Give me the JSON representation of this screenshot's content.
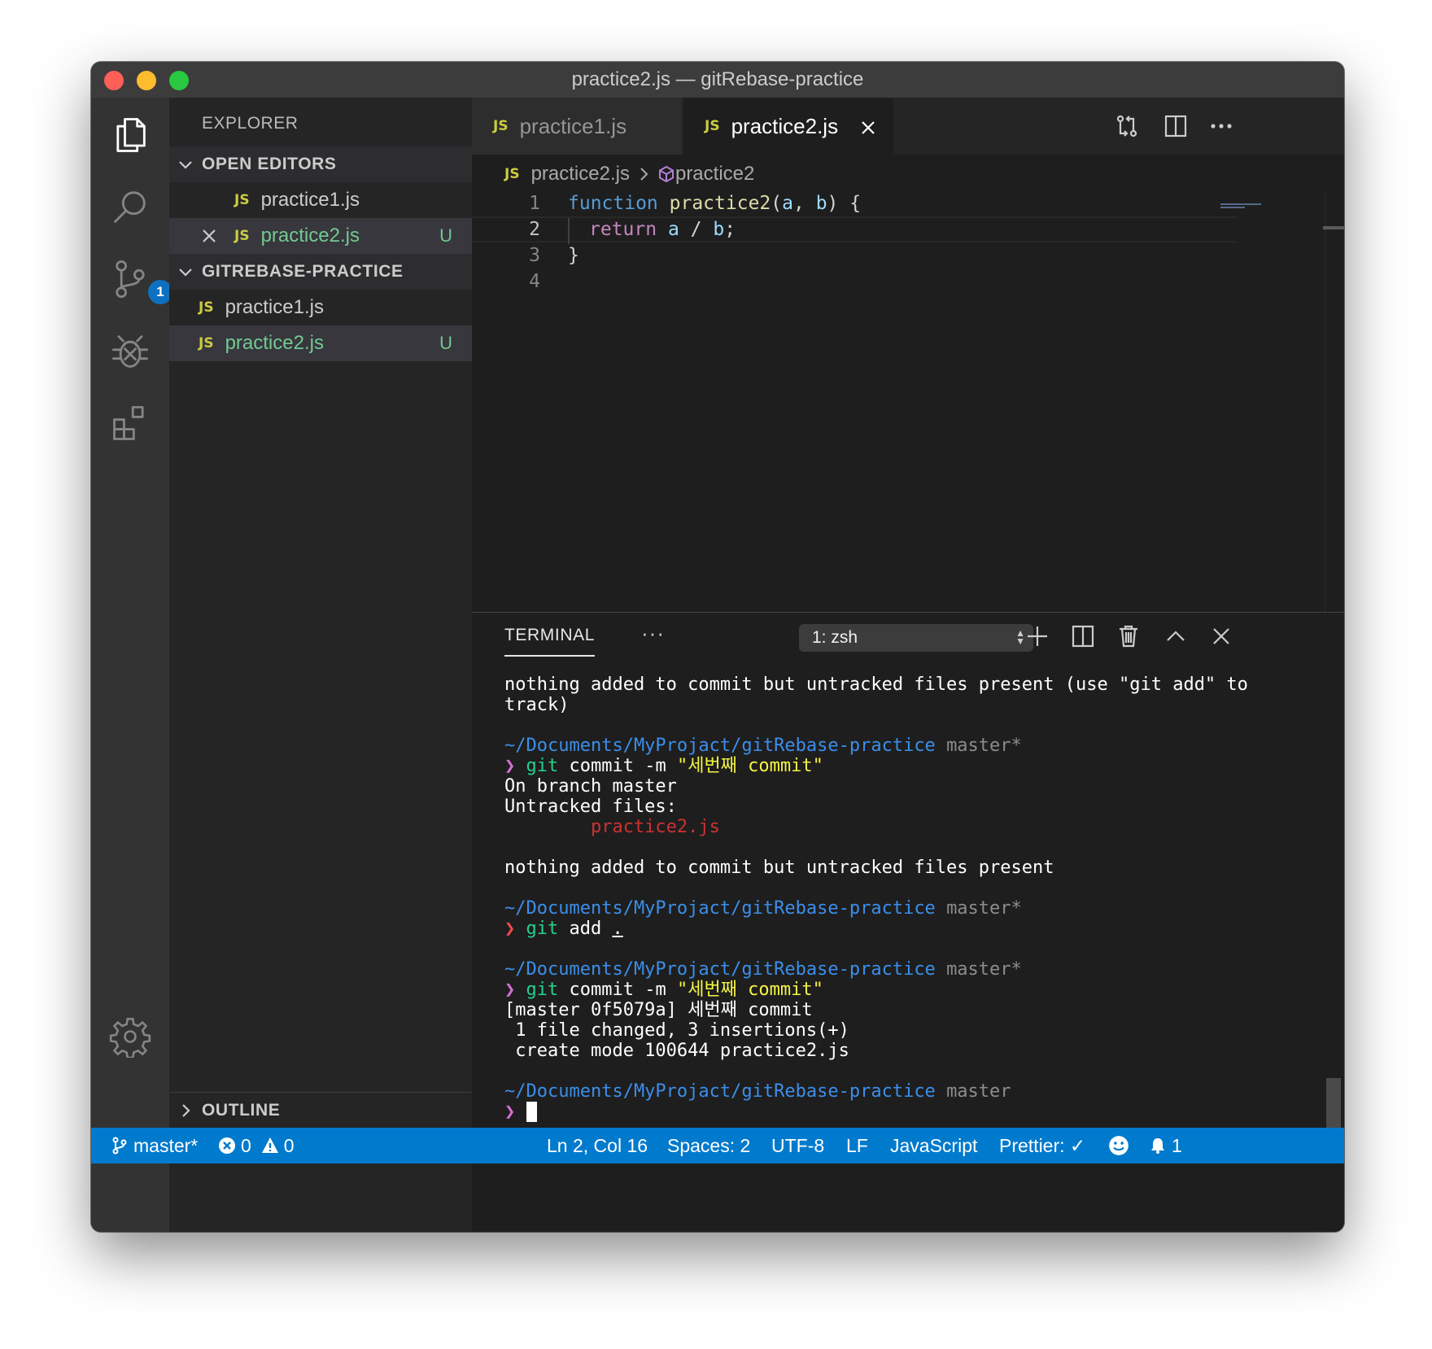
{
  "window": {
    "title": "practice2.js — gitRebase-practice"
  },
  "activity_bar": {
    "items": [
      "files-icon",
      "search-icon",
      "source-control-icon",
      "debug-icon",
      "extensions-icon"
    ],
    "scm_badge": "1"
  },
  "sidebar": {
    "title": "EXPLORER",
    "open_editors": {
      "label": "OPEN EDITORS",
      "items": [
        {
          "badge": "JS",
          "name": "practice1.js",
          "status": ""
        },
        {
          "badge": "JS",
          "name": "practice2.js",
          "status": "U"
        }
      ]
    },
    "workspace": {
      "label": "GITREBASE-PRACTICE",
      "items": [
        {
          "badge": "JS",
          "name": "practice1.js",
          "status": ""
        },
        {
          "badge": "JS",
          "name": "practice2.js",
          "status": "U"
        }
      ]
    },
    "outline_label": "OUTLINE"
  },
  "tabs": [
    {
      "badge": "JS",
      "label": "practice1.js",
      "active": false
    },
    {
      "badge": "JS",
      "label": "practice2.js",
      "active": true
    }
  ],
  "breadcrumb": {
    "badge": "JS",
    "file": "practice2.js",
    "symbol": "practice2"
  },
  "code": {
    "line_numbers": [
      "1",
      "2",
      "3",
      "4"
    ],
    "line1": {
      "kw": "function",
      "name": "practice2",
      "open": "(",
      "p1": "a",
      "sep": ", ",
      "p2": "b",
      "close": ") {"
    },
    "line2": {
      "kw": "return",
      "a": "a",
      "op": " / ",
      "b": "b",
      "end": ";"
    },
    "line3": "}"
  },
  "panel": {
    "tab": "TERMINAL",
    "more": "···",
    "terminal_select": "1: zsh"
  },
  "terminal": {
    "l01": "nothing added to commit but untracked files present (use \"git add\" to",
    "l02": "track)",
    "path": "~/Documents/MyProjact/gitRebase-practice",
    "branch_dirty": "master*",
    "branch_clean": "master",
    "prompt": "❯",
    "git": "git",
    "commit_args": " commit -m ",
    "commit_msg": "\"세번째 commit\"",
    "on_branch": "On branch master",
    "untracked_files": "Untracked files:",
    "untracked_file": "        practice2.js",
    "nothing_added": "nothing added to commit but untracked files present",
    "add_args": " add ",
    "add_dot": ".",
    "commit_result": "[master 0f5079a] 세번째 commit",
    "files_changed": " 1 file changed, 3 insertions(+)",
    "create_mode": " create mode 100644 practice2.js"
  },
  "status_bar": {
    "branch": "master*",
    "errors": "0",
    "warnings": "0",
    "position": "Ln 2, Col 16",
    "spaces": "Spaces: 2",
    "encoding": "UTF-8",
    "eol": "LF",
    "language": "JavaScript",
    "prettier": "Prettier: ✓",
    "notifications": "1"
  },
  "colors": {
    "status_bar": "#007acc",
    "activity_bar": "#333333",
    "sidebar": "#252526",
    "editor": "#1e1e1e"
  }
}
